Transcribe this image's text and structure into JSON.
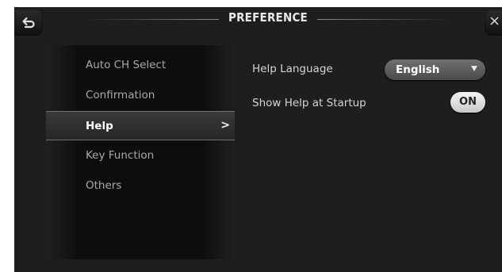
{
  "header": {
    "title": "PREFERENCE",
    "back_icon": "back-arrow-icon",
    "close_icon": "close-icon",
    "close_glyph": "×"
  },
  "sidebar": {
    "items": [
      {
        "label": "Auto CH Select"
      },
      {
        "label": "Confirmation"
      },
      {
        "label": "Help",
        "active": true,
        "chevron": ">"
      },
      {
        "label": "Key Function"
      },
      {
        "label": "Others"
      }
    ]
  },
  "settings": {
    "help_language": {
      "label": "Help Language",
      "value": "English"
    },
    "show_help": {
      "label": "Show Help at Startup",
      "value": "ON"
    }
  },
  "colors": {
    "background": "#1e1e1e",
    "active_item": "#303030",
    "select": "#5c5c5c",
    "toggle_on": "#e0e0e0"
  }
}
